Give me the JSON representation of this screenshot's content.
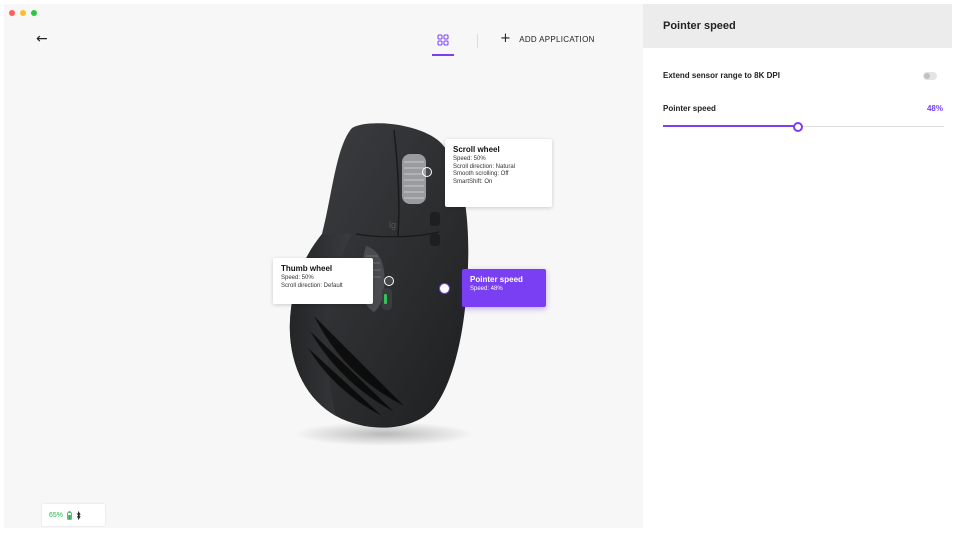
{
  "header": {
    "back_icon": "arrow-left-icon",
    "device_icon": "device-grid-icon",
    "add_application_label": "ADD APPLICATION"
  },
  "callouts": {
    "scroll_wheel": {
      "title": "Scroll wheel",
      "lines": [
        "Speed: 50%",
        "Scroll direction: Natural",
        "Smooth scrolling: Off",
        "SmartShift: On"
      ]
    },
    "thumb_wheel": {
      "title": "Thumb wheel",
      "lines": [
        "Speed: 50%",
        "Scroll direction: Default"
      ]
    },
    "pointer_speed": {
      "title": "Pointer speed",
      "lines": [
        "Speed: 48%"
      ]
    }
  },
  "battery": {
    "level_text": "65%",
    "icons": [
      "battery-charging-icon",
      "bluetooth-icon"
    ]
  },
  "panel": {
    "title": "Pointer speed",
    "extend_label": "Extend sensor range to 8K DPI",
    "extend_enabled": false,
    "speed_label": "Pointer speed",
    "speed_value": "48%",
    "speed_fraction": 0.48
  },
  "colors": {
    "accent": "#7a3ff2",
    "battery_green": "#2bb34a"
  }
}
